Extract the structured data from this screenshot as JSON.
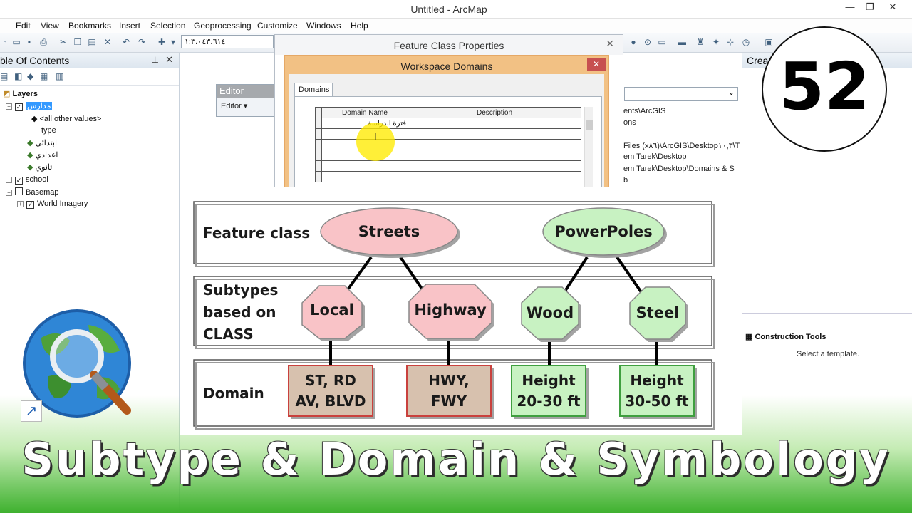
{
  "window": {
    "title": "Untitled - ArcMap",
    "controls": [
      "—",
      "❐",
      "✕"
    ]
  },
  "menu": [
    "Edit",
    "View",
    "Bookmarks",
    "Insert",
    "Selection",
    "Geoprocessing",
    "Customize",
    "Windows",
    "Help"
  ],
  "toolbar": {
    "scale": "١:٣،٠٤٣،٦١٤"
  },
  "toc": {
    "title": "ble Of Contents",
    "layers_label": "Layers",
    "items": [
      {
        "label": "مدارس",
        "checked": true,
        "selected": true
      },
      {
        "label": "<all other values>"
      },
      {
        "label": "type"
      },
      {
        "label": "ابتدائي"
      },
      {
        "label": "اعدادي"
      },
      {
        "label": "ثانوي"
      },
      {
        "label": "school",
        "checked": true
      },
      {
        "label": "Basemap",
        "checked": false
      },
      {
        "label": "World Imagery",
        "checked": true
      }
    ]
  },
  "editor_toolbar": {
    "title": "Editor",
    "menu": "Editor ▾"
  },
  "feature_class_properties": {
    "title": "Feature Class Properties"
  },
  "workspace_domains": {
    "title": "Workspace Domains",
    "tab": "Domains",
    "columns": [
      "Domain Name",
      "Description"
    ],
    "first_value": "فترة الدراسة"
  },
  "catalog_panel": {
    "lines": [
      "ents\\ArcGIS",
      "ons",
      "Files (x٨٦)\\ArcGIS\\Desktop١٠,٣\\T",
      "em Tarek\\Desktop",
      "em Tarek\\Desktop\\Domains & S",
      "b"
    ]
  },
  "right_panel": {
    "title": "Crea",
    "construction_tools": "Construction Tools",
    "select_template": "Select a template."
  },
  "badge": {
    "number": "52"
  },
  "diagram": {
    "rows": [
      "Feature class",
      "Subtypes based on CLASS",
      "Domain"
    ],
    "feature_classes": [
      "Streets",
      "PowerPoles"
    ],
    "subtypes": [
      "Local",
      "Highway",
      "Wood",
      "Steel"
    ],
    "domains": [
      [
        "ST, RD",
        "AV, BLVD"
      ],
      [
        "HWY,",
        "FWY"
      ],
      [
        "Height",
        "20-30 ft"
      ],
      [
        "Height",
        "30-50 ft"
      ]
    ],
    "colors": {
      "pink": "#f9c3c7",
      "green": "#c8f2c2",
      "brown": "#d7c1ae"
    }
  },
  "video_title": "Subtype & Domain & Symbology"
}
